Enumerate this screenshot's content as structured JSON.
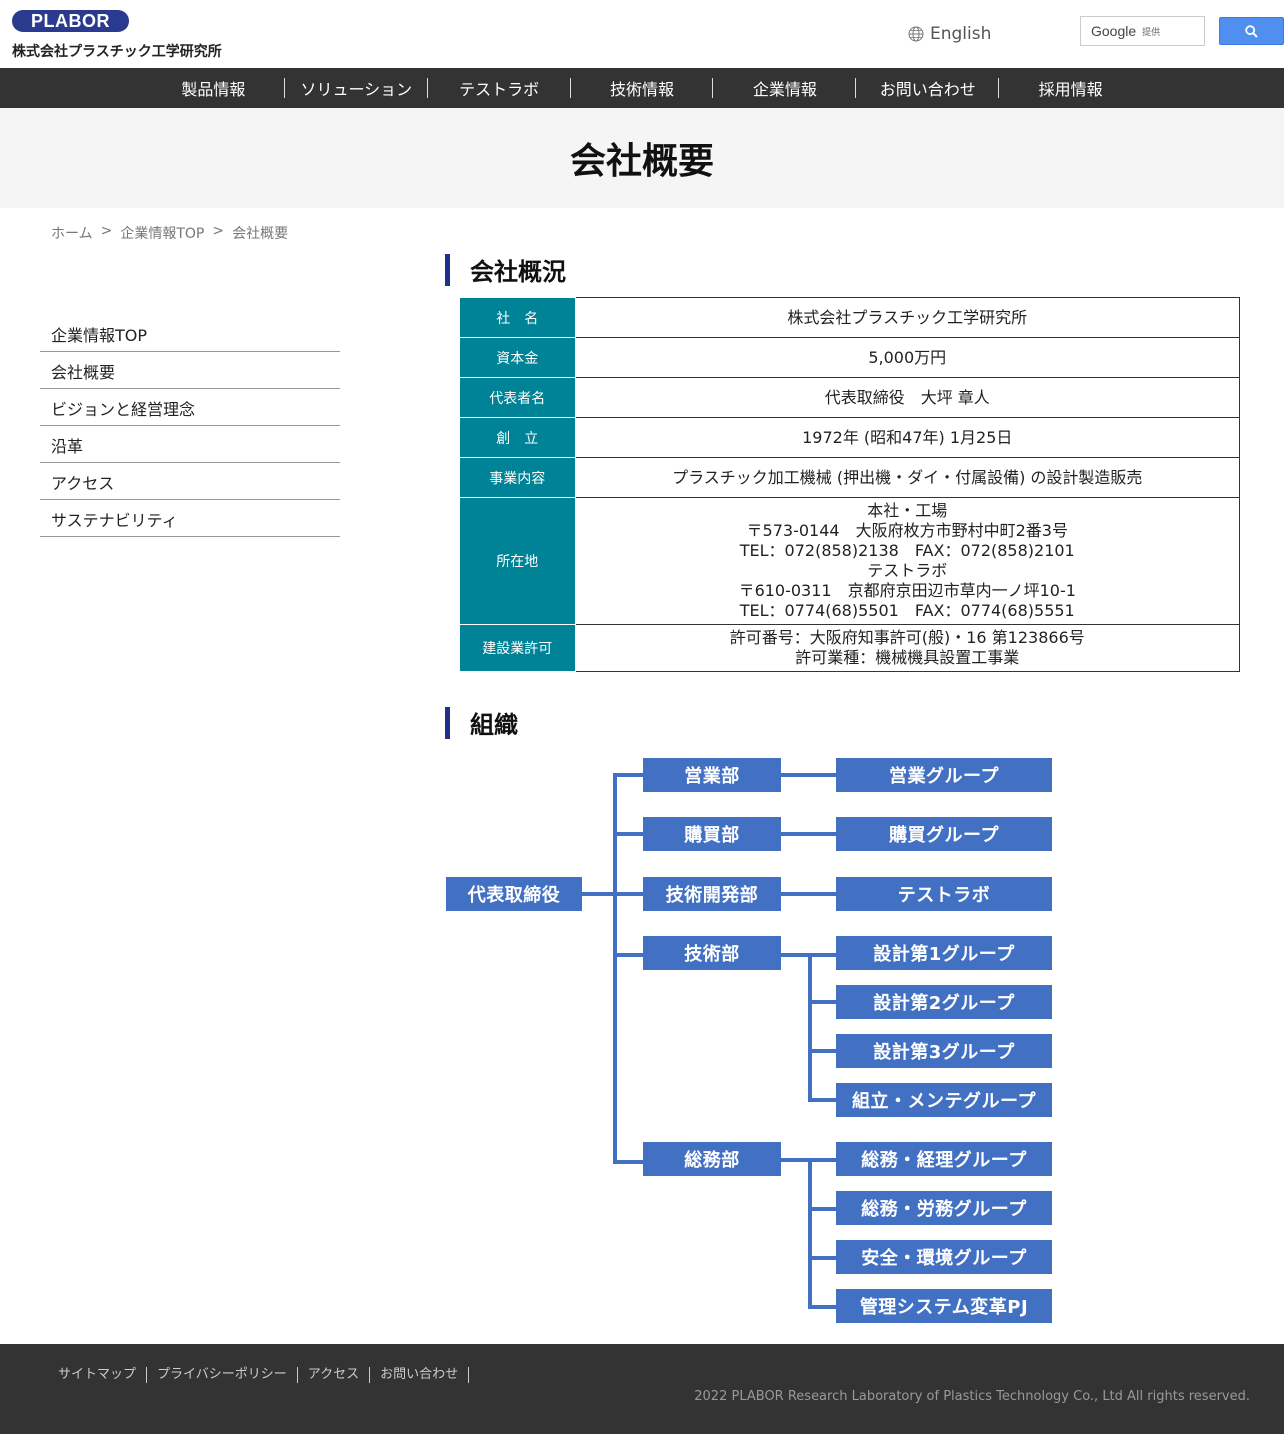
{
  "header": {
    "logo": "PLABOR",
    "company_name": "株式会社プラスチック工学研究所",
    "language": "English",
    "search": {
      "brand": "Google",
      "provided": "提供"
    }
  },
  "nav": [
    "製品情報",
    "ソリューション",
    "テストラボ",
    "技術情報",
    "企業情報",
    "お問い合わせ",
    "採用情報"
  ],
  "page_title": "会社概要",
  "breadcrumb": [
    "ホーム",
    ">",
    "企業情報TOP",
    ">",
    "会社概要"
  ],
  "sidebar": [
    "企業情報TOP",
    "会社概要",
    "ビジョンと経営理念",
    "沿革",
    "アクセス",
    "サステナビリティ"
  ],
  "overview": {
    "heading": "会社概況",
    "rows": [
      {
        "label": "社　名",
        "lines": [
          "株式会社プラスチック工学研究所"
        ]
      },
      {
        "label": "資本金",
        "lines": [
          "5,000万円"
        ]
      },
      {
        "label": "代表者名",
        "lines": [
          "代表取締役　大坪 章人"
        ]
      },
      {
        "label": "創　立",
        "lines": [
          "1972年 (昭和47年) 1月25日"
        ]
      },
      {
        "label": "事業内容",
        "lines": [
          "プラスチック加工機械 (押出機・ダイ・付属設備) の設計製造販売"
        ]
      },
      {
        "label": "所在地",
        "lines": [
          "本社・工場",
          "〒573-0144　大阪府枚方市野村中町2番3号",
          "TEL：072(858)2138　FAX：072(858)2101",
          "テストラボ",
          "〒610-0311　京都府京田辺市草内一ノ坪10-1",
          "TEL：0774(68)5501　FAX：0774(68)5551"
        ]
      },
      {
        "label": "建設業許可",
        "lines": [
          "許可番号：大阪府知事許可(般)・16 第123866号",
          "許可業種：機械機具設置工事業"
        ]
      }
    ]
  },
  "organization": {
    "heading": "組織",
    "root": "代表取締役",
    "departments": [
      {
        "name": "営業部",
        "groups": [
          "営業グループ"
        ]
      },
      {
        "name": "購買部",
        "groups": [
          "購買グループ"
        ]
      },
      {
        "name": "技術開発部",
        "groups": [
          "テストラボ"
        ]
      },
      {
        "name": "技術部",
        "groups": [
          "設計第1グループ",
          "設計第2グループ",
          "設計第3グループ",
          "組立・メンテグループ"
        ]
      },
      {
        "name": "総務部",
        "groups": [
          "総務・経理グループ",
          "総務・労務グループ",
          "安全・環境グループ",
          "管理システム変革PJ"
        ]
      }
    ]
  },
  "footer": {
    "links": [
      "サイトマップ",
      "プライバシーポリシー",
      "アクセス",
      "お問い合わせ"
    ],
    "copyright": "2022 PLABOR Research Laboratory of Plastics Technology Co., Ltd All rights reserved."
  },
  "colors": {
    "nav_bg": "#333333",
    "table_header": "#008396",
    "org_box": "#4271c4",
    "heading_bar": "#1f2f8c",
    "footer_bg": "#333333"
  }
}
